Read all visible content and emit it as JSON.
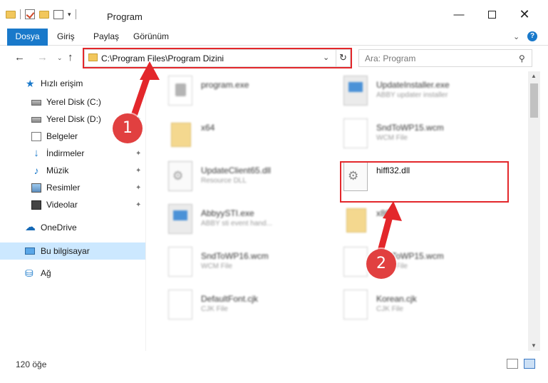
{
  "window": {
    "title": "Program",
    "minimize_glyph": "—",
    "close_glyph": "✕"
  },
  "ribbon": {
    "tabs": [
      "Dosya",
      "Giriş",
      "Paylaş",
      "Görünüm"
    ],
    "chevron": "⌄",
    "help": "?"
  },
  "nav": {
    "back": "←",
    "forward": "→",
    "recent": "⌄",
    "up": "↑",
    "address": "C:\\Program Files\\Program Dizini",
    "address_dropdown": "⌄",
    "refresh": "↻",
    "search_placeholder": "Ara: Program",
    "search_glyph": "⚲"
  },
  "sidebar": {
    "items": [
      {
        "label": "Hızlı erişim",
        "icon": "quick-access-star-icon"
      },
      {
        "label": "Yerel Disk (C:)",
        "icon": "drive-icon",
        "pinned": true
      },
      {
        "label": "Yerel Disk (D:)",
        "icon": "drive-icon",
        "pinned": true
      },
      {
        "label": "Belgeler",
        "icon": "documents-icon",
        "pinned": true
      },
      {
        "label": "İndirmeler",
        "icon": "downloads-icon",
        "pinned": true
      },
      {
        "label": "Müzik",
        "icon": "music-icon",
        "pinned": true
      },
      {
        "label": "Resimler",
        "icon": "pictures-icon",
        "pinned": true
      },
      {
        "label": "Videolar",
        "icon": "videos-icon",
        "pinned": true
      },
      {
        "label": "OneDrive",
        "icon": "onedrive-icon"
      },
      {
        "label": "Bu bilgisayar",
        "icon": "this-pc-icon",
        "selected": true
      },
      {
        "label": "Ağ",
        "icon": "network-icon"
      }
    ],
    "pin_glyph": "📌"
  },
  "files": [
    {
      "name": "program.exe",
      "type": "",
      "icon": "program-exe-icon"
    },
    {
      "name": "UpdateInstaller.exe",
      "type": "ABBY updater installer",
      "icon": "exe-icon"
    },
    {
      "name": "x64",
      "type": "",
      "icon": "folder-icon"
    },
    {
      "name": "SndToWP15.wcm",
      "type": "WCM File",
      "icon": "file-icon"
    },
    {
      "name": "UpdateClient65.dll",
      "type": "Resource DLL",
      "icon": "dll-icon"
    },
    {
      "name": "hiffl32.dll",
      "type": "",
      "icon": "dll-gear-icon"
    },
    {
      "name": "AbbyySTI.exe",
      "type": "ABBY sti event hand...",
      "icon": "exe-icon"
    },
    {
      "name": "x86",
      "type": "",
      "icon": "folder-icon"
    },
    {
      "name": "SndToWP16.wcm",
      "type": "WCM File",
      "icon": "file-icon"
    },
    {
      "name": "SndToWP15.wcm",
      "type": "WCM File",
      "icon": "file-icon"
    },
    {
      "name": "DefaultFont.cjk",
      "type": "CJK File",
      "icon": "file-icon"
    },
    {
      "name": "Korean.cjk",
      "type": "CJK File",
      "icon": "file-icon"
    }
  ],
  "annotations": {
    "step1": "1",
    "step2": "2",
    "color": "#e3272b"
  },
  "status": {
    "count": "120 öğe"
  }
}
